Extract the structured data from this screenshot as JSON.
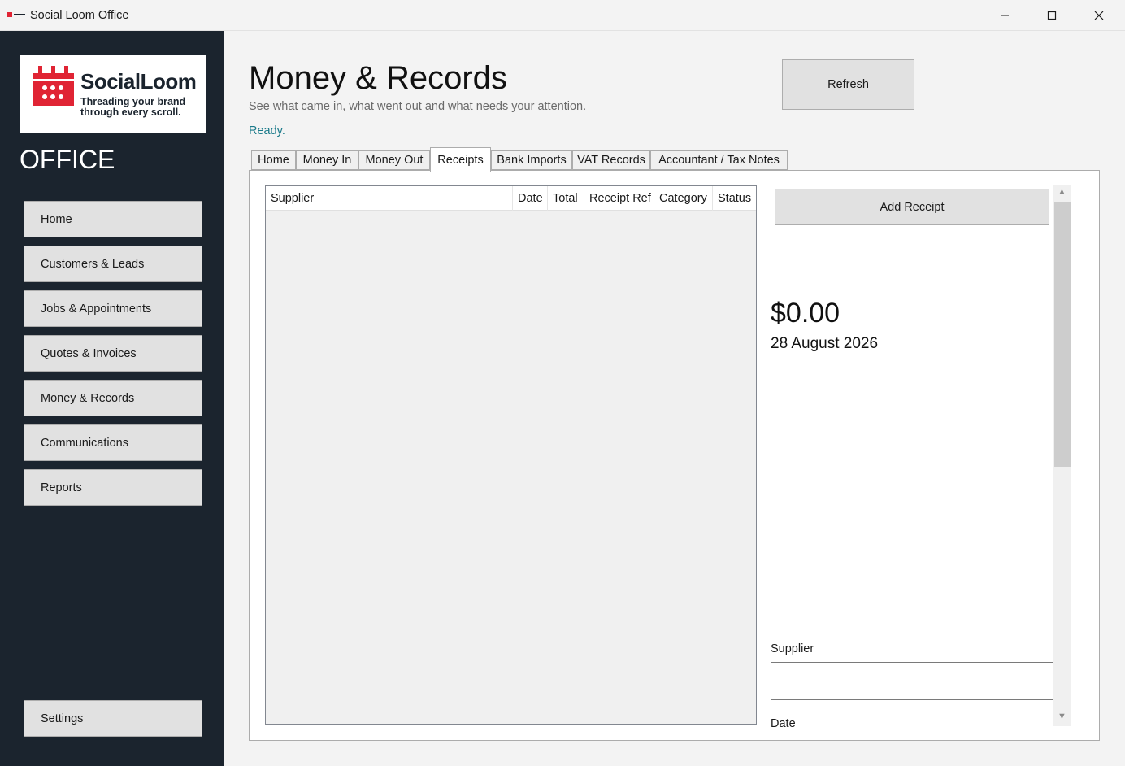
{
  "window": {
    "title": "Social Loom Office"
  },
  "sidebar": {
    "logo": {
      "name": "SocialLoom",
      "tagline": "Threading your brand through every scroll.",
      "color": "#e02434"
    },
    "section_title": "OFFICE",
    "nav": [
      {
        "label": "Home"
      },
      {
        "label": "Customers & Leads"
      },
      {
        "label": "Jobs & Appointments"
      },
      {
        "label": "Quotes & Invoices"
      },
      {
        "label": "Money & Records"
      },
      {
        "label": "Communications"
      },
      {
        "label": "Reports"
      }
    ],
    "settings_label": "Settings"
  },
  "header": {
    "title": "Money & Records",
    "subtitle": "See what came in, what went out and what needs your attention.",
    "status": "Ready.",
    "refresh_label": "Refresh"
  },
  "tabs": [
    {
      "label": "Home"
    },
    {
      "label": "Money In"
    },
    {
      "label": "Money Out"
    },
    {
      "label": "Receipts"
    },
    {
      "label": "Bank Imports"
    },
    {
      "label": "VAT Records"
    },
    {
      "label": "Accountant / Tax Notes"
    }
  ],
  "active_tab": "Receipts",
  "grid": {
    "columns": [
      "Supplier",
      "Date",
      "Total",
      "Receipt Ref",
      "Category",
      "Status"
    ],
    "rows": []
  },
  "details": {
    "add_label": "Add Receipt",
    "amount": "$0.00",
    "date": "28 August 2026",
    "supplier_label": "Supplier",
    "supplier_value": "",
    "date_label": "Date"
  }
}
